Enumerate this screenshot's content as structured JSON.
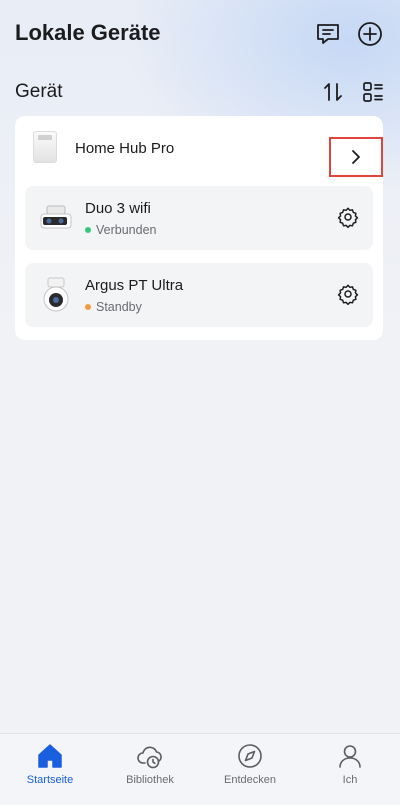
{
  "header": {
    "title": "Lokale Geräte",
    "message_icon": "message-icon",
    "add_icon": "add-icon"
  },
  "section": {
    "title": "Gerät",
    "sort_icon": "sort-icon",
    "layout_icon": "grid-layout-icon"
  },
  "hub": {
    "name": "Home Hub Pro",
    "chevron_icon": "chevron-right-icon"
  },
  "cameras": [
    {
      "name": "Duo 3 wifi",
      "status": "Verbunden",
      "status_color": "#34c77b",
      "settings_icon": "gear-icon"
    },
    {
      "name": "Argus PT Ultra",
      "status": "Standby",
      "status_color": "#f19a3e",
      "settings_icon": "gear-icon"
    }
  ],
  "tabbar": {
    "active_color": "#1a5fe0",
    "tabs": [
      {
        "label": "Startseite",
        "icon": "home-icon",
        "active": true
      },
      {
        "label": "Bibliothek",
        "icon": "cloud-clock-icon",
        "active": false
      },
      {
        "label": "Entdecken",
        "icon": "compass-icon",
        "active": false
      },
      {
        "label": "Ich",
        "icon": "person-icon",
        "active": false
      }
    ]
  }
}
